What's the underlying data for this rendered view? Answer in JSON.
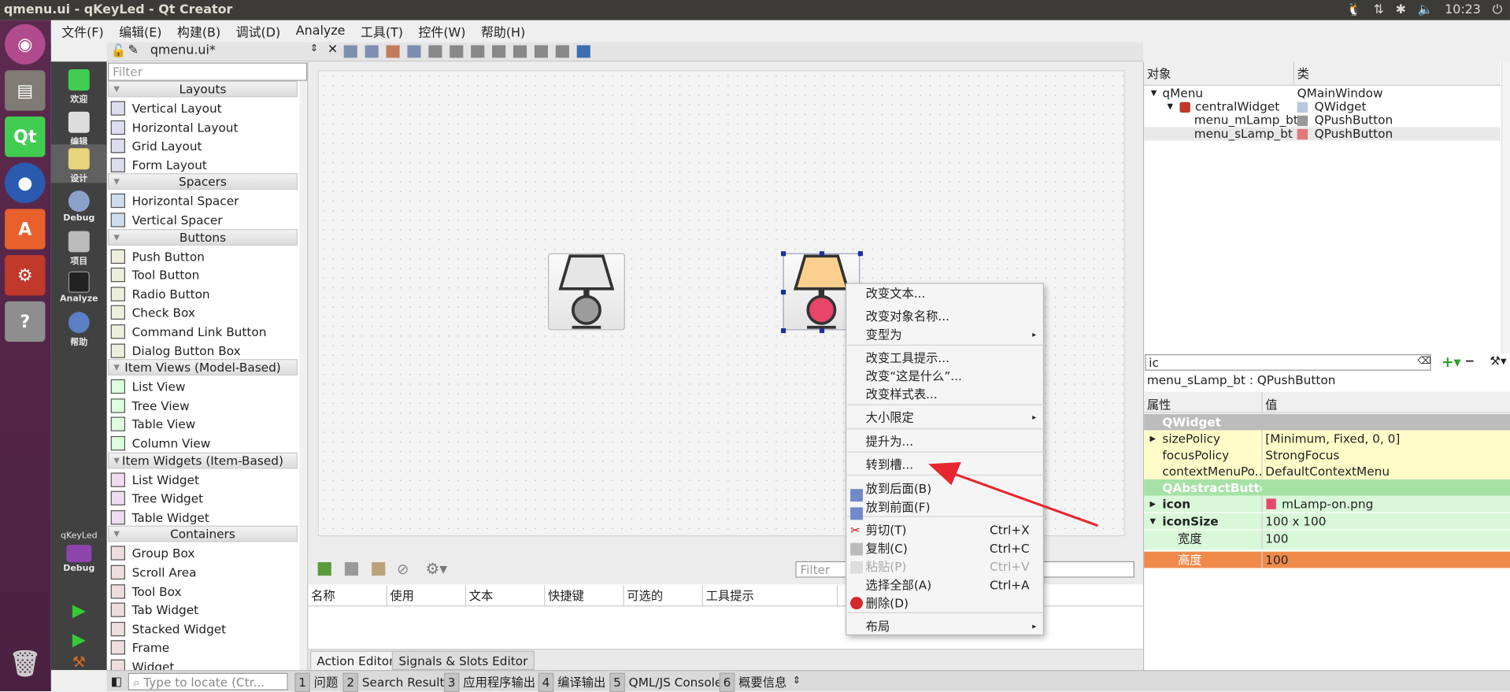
{
  "window_title": "qmenu.ui - qKeyLed - Qt Creator",
  "clock": "10:23",
  "menubar": [
    "文件(F)",
    "编辑(E)",
    "构建(B)",
    "调试(D)",
    "Analyze",
    "工具(T)",
    "控件(W)",
    "帮助(H)"
  ],
  "modes": [
    "欢迎",
    "编辑",
    "设计",
    "Debug",
    "项目",
    "Analyze",
    "帮助"
  ],
  "kit": {
    "project": "qKeyLed",
    "mode": "Debug"
  },
  "editor_tab": "qmenu.ui*",
  "widget_box": {
    "filter_placeholder": "Filter",
    "categories": [
      {
        "name": "Layouts",
        "items": [
          "Vertical Layout",
          "Horizontal Layout",
          "Grid Layout",
          "Form Layout"
        ]
      },
      {
        "name": "Spacers",
        "items": [
          "Horizontal Spacer",
          "Vertical Spacer"
        ]
      },
      {
        "name": "Buttons",
        "items": [
          "Push Button",
          "Tool Button",
          "Radio Button",
          "Check Box",
          "Command Link Button",
          "Dialog Button Box"
        ]
      },
      {
        "name": "Item Views (Model-Based)",
        "items": [
          "List View",
          "Tree View",
          "Table View",
          "Column View"
        ]
      },
      {
        "name": "Item Widgets (Item-Based)",
        "items": [
          "List Widget",
          "Tree Widget",
          "Table Widget"
        ]
      },
      {
        "name": "Containers",
        "items": [
          "Group Box",
          "Scroll Area",
          "Tool Box",
          "Tab Widget",
          "Stacked Widget",
          "Frame",
          "Widget"
        ]
      }
    ]
  },
  "context_menu": {
    "items": [
      {
        "label": "改变文本...",
        "shortcut": "",
        "submenu": false,
        "disabled": false
      },
      {
        "label": "改变对象名称...",
        "shortcut": "",
        "submenu": false,
        "disabled": false
      },
      {
        "label": "变型为",
        "shortcut": "",
        "submenu": true,
        "disabled": false
      },
      {
        "label": "改变工具提示...",
        "shortcut": "",
        "submenu": false,
        "disabled": false
      },
      {
        "label": "改变“这是什么”...",
        "shortcut": "",
        "submenu": false,
        "disabled": false
      },
      {
        "label": "改变样式表...",
        "shortcut": "",
        "submenu": false,
        "disabled": false
      },
      {
        "label": "大小限定",
        "shortcut": "",
        "submenu": true,
        "disabled": false
      },
      {
        "label": "提升为...",
        "shortcut": "",
        "submenu": false,
        "disabled": false
      },
      {
        "label": "转到槽...",
        "shortcut": "",
        "submenu": false,
        "disabled": false
      },
      {
        "label": "放到后面(B)",
        "shortcut": "",
        "submenu": false,
        "disabled": false
      },
      {
        "label": "放到前面(F)",
        "shortcut": "",
        "submenu": false,
        "disabled": false
      },
      {
        "label": "剪切(T)",
        "shortcut": "Ctrl+X",
        "submenu": false,
        "disabled": false
      },
      {
        "label": "复制(C)",
        "shortcut": "Ctrl+C",
        "submenu": false,
        "disabled": false
      },
      {
        "label": "粘贴(P)",
        "shortcut": "Ctrl+V",
        "submenu": false,
        "disabled": true
      },
      {
        "label": "选择全部(A)",
        "shortcut": "Ctrl+A",
        "submenu": false,
        "disabled": false
      },
      {
        "label": "删除(D)",
        "shortcut": "",
        "submenu": false,
        "disabled": false
      },
      {
        "label": "布局",
        "shortcut": "",
        "submenu": true,
        "disabled": false
      }
    ]
  },
  "action_editor": {
    "filter_placeholder": "Filter",
    "columns": [
      "名称",
      "使用",
      "文本",
      "快捷键",
      "可选的",
      "工具提示"
    ],
    "tabs": [
      "Action Editor",
      "Signals & Slots Editor"
    ]
  },
  "object_inspector": {
    "columns": [
      "对象",
      "类"
    ],
    "rows": [
      {
        "object": "qMenu",
        "class": "QMainWindow"
      },
      {
        "object": "centralWidget",
        "class": "QWidget"
      },
      {
        "object": "menu_mLamp_bt",
        "class": "QPushButton"
      },
      {
        "object": "menu_sLamp_bt",
        "class": "QPushButton"
      }
    ]
  },
  "property_editor": {
    "filter_value": "ic",
    "class_label": "menu_sLamp_bt : QPushButton",
    "columns": [
      "属性",
      "值"
    ],
    "rows": [
      {
        "name": "QWidget",
        "value": "",
        "group": true,
        "bold": false
      },
      {
        "name": "sizePolicy",
        "value": "[Minimum, Fixed, 0, 0]",
        "group": false,
        "bold": false
      },
      {
        "name": "focusPolicy",
        "value": "StrongFocus",
        "group": false,
        "bold": false
      },
      {
        "name": "contextMenuPo...",
        "value": "DefaultContextMenu",
        "group": false,
        "bold": false
      },
      {
        "name": "QAbstractButton",
        "value": "",
        "group": true,
        "bold": false
      },
      {
        "name": "icon",
        "value": "mLamp-on.png",
        "group": false,
        "bold": true
      },
      {
        "name": "iconSize",
        "value": "100 x 100",
        "group": false,
        "bold": true
      },
      {
        "name": "宽度",
        "value": "100",
        "group": false,
        "bold": false
      },
      {
        "name": "高度",
        "value": "100",
        "group": false,
        "bold": false
      }
    ]
  },
  "status_bar": {
    "locator_placeholder": "Type to locate (Ctr...",
    "panes": [
      {
        "num": "1",
        "label": "问题"
      },
      {
        "num": "2",
        "label": "Search Results"
      },
      {
        "num": "3",
        "label": "应用程序输出"
      },
      {
        "num": "4",
        "label": "编译输出"
      },
      {
        "num": "5",
        "label": "QML/JS Console"
      },
      {
        "num": "6",
        "label": "概要信息"
      }
    ]
  },
  "colors": {
    "launcher": "#5d2a4f",
    "selected_row": "#f08a4b",
    "lamp_on_shade": "#fbd08e",
    "lamp_on_base": "#e8456b",
    "arrow": "#e8262f"
  }
}
